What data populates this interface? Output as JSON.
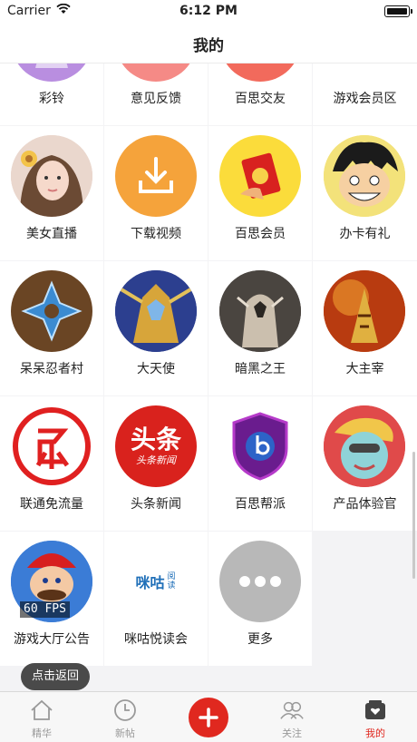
{
  "status_bar": {
    "carrier": "Carrier",
    "time": "6:12 PM"
  },
  "nav": {
    "title": "我的"
  },
  "grid": [
    {
      "label": "彩铃",
      "icon": "ringtone-icon",
      "color": "#b98ee0"
    },
    {
      "label": "意见反馈",
      "icon": "feedback-icon",
      "color": "#f58a86"
    },
    {
      "label": "百思交友",
      "icon": "friends-icon",
      "color": "#f26a5c"
    },
    {
      "label": "游戏会员区",
      "icon": "game-vip-icon",
      "color": "#ffffff"
    },
    {
      "label": "美女直播",
      "icon": "live-stream-avatar-icon",
      "color": "#e9cfc6"
    },
    {
      "label": "下载视频",
      "icon": "download-video-icon",
      "color": "#f5a33b"
    },
    {
      "label": "百思会员",
      "icon": "vip-card-icon",
      "color": "#fbdc3b"
    },
    {
      "label": "办卡有礼",
      "icon": "cartoon-face-icon",
      "color": "#f5e06a"
    },
    {
      "label": "呆呆忍者村",
      "icon": "ninja-star-icon",
      "color": "#6a4524"
    },
    {
      "label": "大天使",
      "icon": "angel-warrior-icon",
      "color": "#2c3f8f"
    },
    {
      "label": "暗黑之王",
      "icon": "dark-king-icon",
      "color": "#4a4540"
    },
    {
      "label": "大主宰",
      "icon": "sovereign-icon",
      "color": "#c94a12"
    },
    {
      "label": "联通免流量",
      "icon": "free-data-icon",
      "color": "#ffffff"
    },
    {
      "label": "头条新闻",
      "icon": "headline-news-icon",
      "color": "#d9221d",
      "logo_main": "头条",
      "logo_sub": "头条新闻"
    },
    {
      "label": "百思帮派",
      "icon": "gang-shield-icon",
      "color": "#ffffff"
    },
    {
      "label": "产品体验官",
      "icon": "product-tester-icon",
      "color": "#e04a4a"
    },
    {
      "label": "游戏大厅公告",
      "icon": "game-hall-icon",
      "color": "#3b7cd6",
      "badge": "60 FPS"
    },
    {
      "label": "咪咕悦读会",
      "icon": "migu-reading-icon",
      "color": "#ffffff",
      "logo_text": "咪咕",
      "logo_sub": "阅读"
    },
    {
      "label": "更多",
      "icon": "more-icon",
      "color": "#b8b8b8"
    }
  ],
  "toast": {
    "text": "点击返回"
  },
  "tabs": [
    {
      "label": "精华",
      "icon": "home-icon"
    },
    {
      "label": "新帖",
      "icon": "clock-icon"
    },
    {
      "label": "",
      "icon": "plus-icon"
    },
    {
      "label": "关注",
      "icon": "people-icon"
    },
    {
      "label": "我的",
      "icon": "profile-box-icon",
      "active": true
    }
  ]
}
